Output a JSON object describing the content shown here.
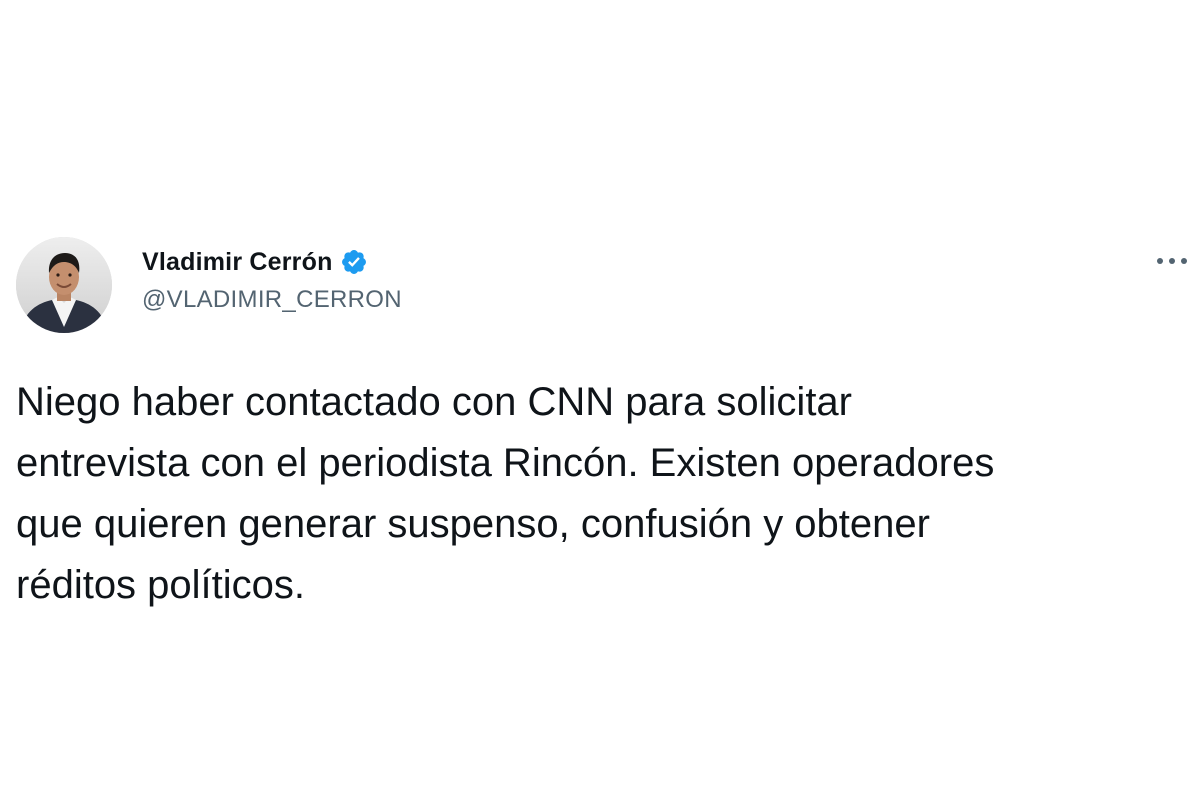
{
  "tweet": {
    "author": {
      "display_name": "Vladimir Cerrón",
      "handle": "@VLADIMIR_CERRON",
      "verified": true,
      "avatar_icon": "profile-photo",
      "verified_icon": "verified-badge-icon",
      "verified_color": "#1d9bf0"
    },
    "more_icon": "more-options-icon",
    "text": "Niego haber contactado con CNN para solicitar\nentrevista con el periodista Rincón. Existen operadores\nque quieren generar suspenso, confusión y obtener\nréditos políticos."
  },
  "colors": {
    "text_primary": "#0f1419",
    "text_secondary": "#536471",
    "accent": "#1d9bf0",
    "background": "#ffffff"
  }
}
